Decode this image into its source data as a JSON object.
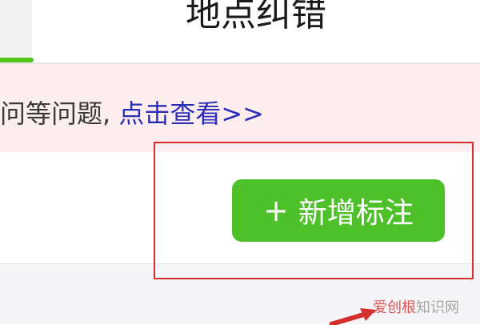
{
  "header": {
    "title": "地点纠错"
  },
  "notice": {
    "text": "问等问题, ",
    "link_label": "点击查看>>"
  },
  "actions": {
    "add_label": "新增标注",
    "add_icon": "plus-icon"
  },
  "watermark": {
    "brand": "爱创根",
    "suffix": "知识网"
  },
  "colors": {
    "accent_green": "#4ec12a",
    "tab_indicator": "#52c41a",
    "notice_background": "#fcedee",
    "link_blue": "#2b2fb8",
    "annotation_red": "#d32f2f"
  }
}
